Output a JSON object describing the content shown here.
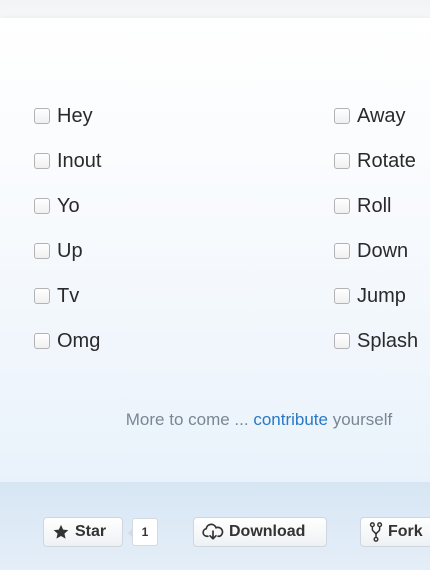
{
  "options_left": [
    "Hey",
    "Inout",
    "Yo",
    "Up",
    "Tv",
    "Omg"
  ],
  "options_right": [
    "Away",
    "Rotate",
    "Roll",
    "Down",
    "Jump",
    "Splash"
  ],
  "more": {
    "prefix": "More to come ... ",
    "link": "contribute",
    "suffix": " yourself"
  },
  "footer": {
    "star_label": "Star",
    "star_count": "1",
    "download_label": "Download",
    "fork_label": "Fork",
    "star_icon": "star-icon",
    "download_icon": "cloud-download-icon",
    "fork_icon": "fork-icon"
  },
  "colors": {
    "link": "#2a79c6",
    "muted_text": "#7a8793",
    "background": "#e4eef8"
  }
}
